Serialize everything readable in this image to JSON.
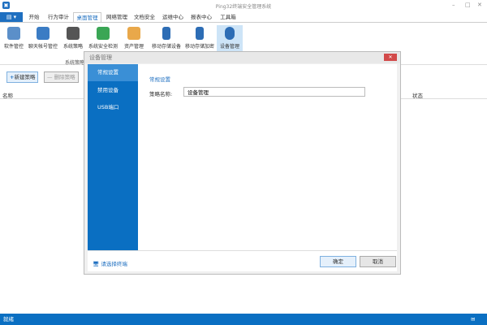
{
  "window": {
    "title": "Ping32终端安全管理系统",
    "minimize": "–",
    "maximize": "□",
    "close": "✕"
  },
  "tabs": [
    "开始",
    "行为审计",
    "桌面管理",
    "网络管理",
    "文档安全",
    "运维中心",
    "报表中心",
    "工具箱"
  ],
  "file_button": "▤ ▾",
  "ribbon": {
    "buttons": [
      "软件管控",
      "聊天帐号管控",
      "系统策略",
      "系统安全检测",
      "资产管理",
      "移动存储设备",
      "移动存储加密",
      "设备管理"
    ],
    "group_label": "系统策略"
  },
  "toolbar": {
    "new": "新建策略",
    "delete": "删除策略"
  },
  "table": {
    "columns": [
      "名称",
      "状态"
    ]
  },
  "status": {
    "text": "就绪"
  },
  "dialog": {
    "title": "设备管理",
    "close": "✕",
    "nav": [
      "常规设置",
      "禁用设备",
      "USB端口"
    ],
    "section_title": "常规设置",
    "name_label": "策略名称:",
    "name_value": "设备管理",
    "select_terminal": "请选择终端",
    "ok": "确定",
    "cancel": "取消"
  }
}
